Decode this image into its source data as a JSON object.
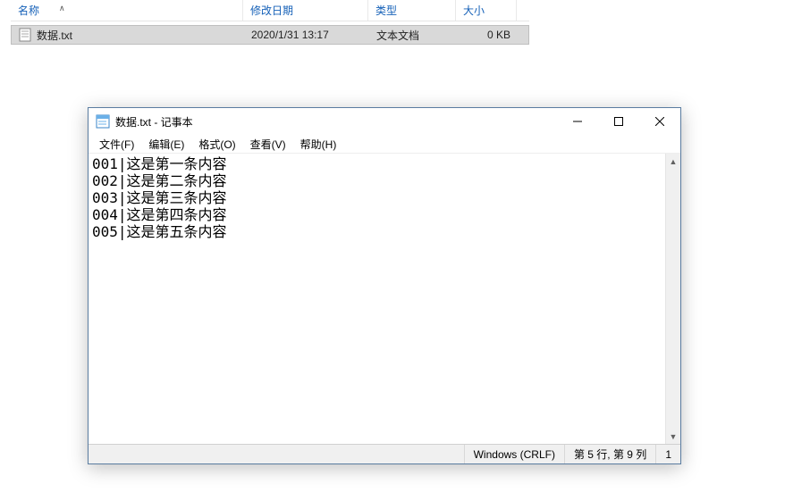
{
  "explorer": {
    "columns": {
      "name": "名称",
      "date": "修改日期",
      "type": "类型",
      "size": "大小"
    },
    "row": {
      "name": "数据.txt",
      "date": "2020/1/31 13:17",
      "type": "文本文档",
      "size": "0 KB"
    }
  },
  "notepad": {
    "title": "数据.txt - 记事本",
    "menu": {
      "file": "文件(F)",
      "edit": "编辑(E)",
      "format": "格式(O)",
      "view": "查看(V)",
      "help": "帮助(H)"
    },
    "content": "001|这是第一条内容\n002|这是第二条内容\n003|这是第三条内容\n004|这是第四条内容\n005|这是第五条内容",
    "status": {
      "encoding": "Windows (CRLF)",
      "cursor": "第 5 行, 第 9 列",
      "zoom": "1"
    }
  }
}
